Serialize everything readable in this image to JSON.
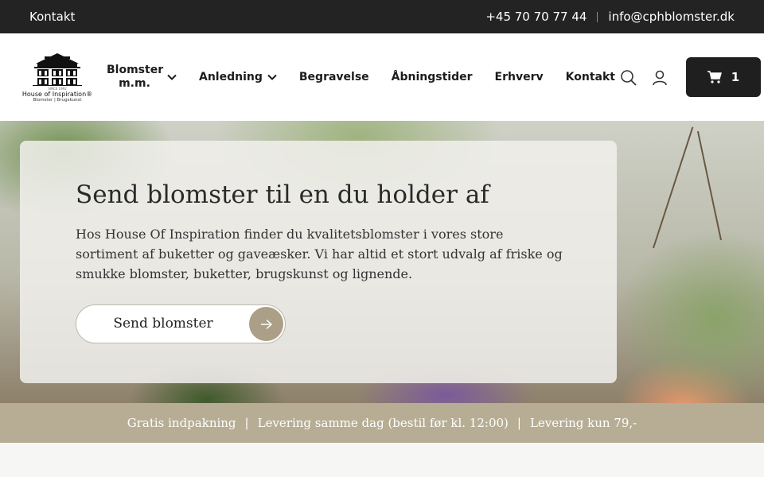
{
  "topbar": {
    "contact_link": "Kontakt",
    "phone": "+45 70 70 77 44",
    "email": "info@cphblomster.dk"
  },
  "logo": {
    "tag_small": "SINCE 1992",
    "brand": "House of Inspiration®",
    "sub": "Blomster | Brugskunst"
  },
  "nav": {
    "items": [
      {
        "label": "Blomster m.m.",
        "has_dropdown": true
      },
      {
        "label": "Anledning",
        "has_dropdown": true
      },
      {
        "label": "Begravelse",
        "has_dropdown": false
      },
      {
        "label": "Åbningstider",
        "has_dropdown": false
      },
      {
        "label": "Erhverv",
        "has_dropdown": false
      },
      {
        "label": "Kontakt",
        "has_dropdown": false
      }
    ]
  },
  "header": {
    "search_icon": "search-icon",
    "account_icon": "user-icon",
    "cart_icon": "cart-icon",
    "cart_count": "1"
  },
  "hero": {
    "title": "Send blomster til en du holder af",
    "text": "Hos House Of Inspiration finder du kvalitetsblomster i vores store sortiment af buketter og gaveæsker. Vi har altid et stort udvalg af friske og smukke blomster, buketter, brugskunst og lignende.",
    "button_label": "Send blomster"
  },
  "usp": {
    "items": [
      "Gratis indpakning",
      "Levering samme dag (bestil før kl. 12:00)",
      "Levering kun 79,-"
    ],
    "separator": "|"
  },
  "colors": {
    "topbar_bg": "#232323",
    "cart_bg": "#1f1f1f",
    "usp_bg": "#b7ad94",
    "accent": "#ab9f87"
  }
}
